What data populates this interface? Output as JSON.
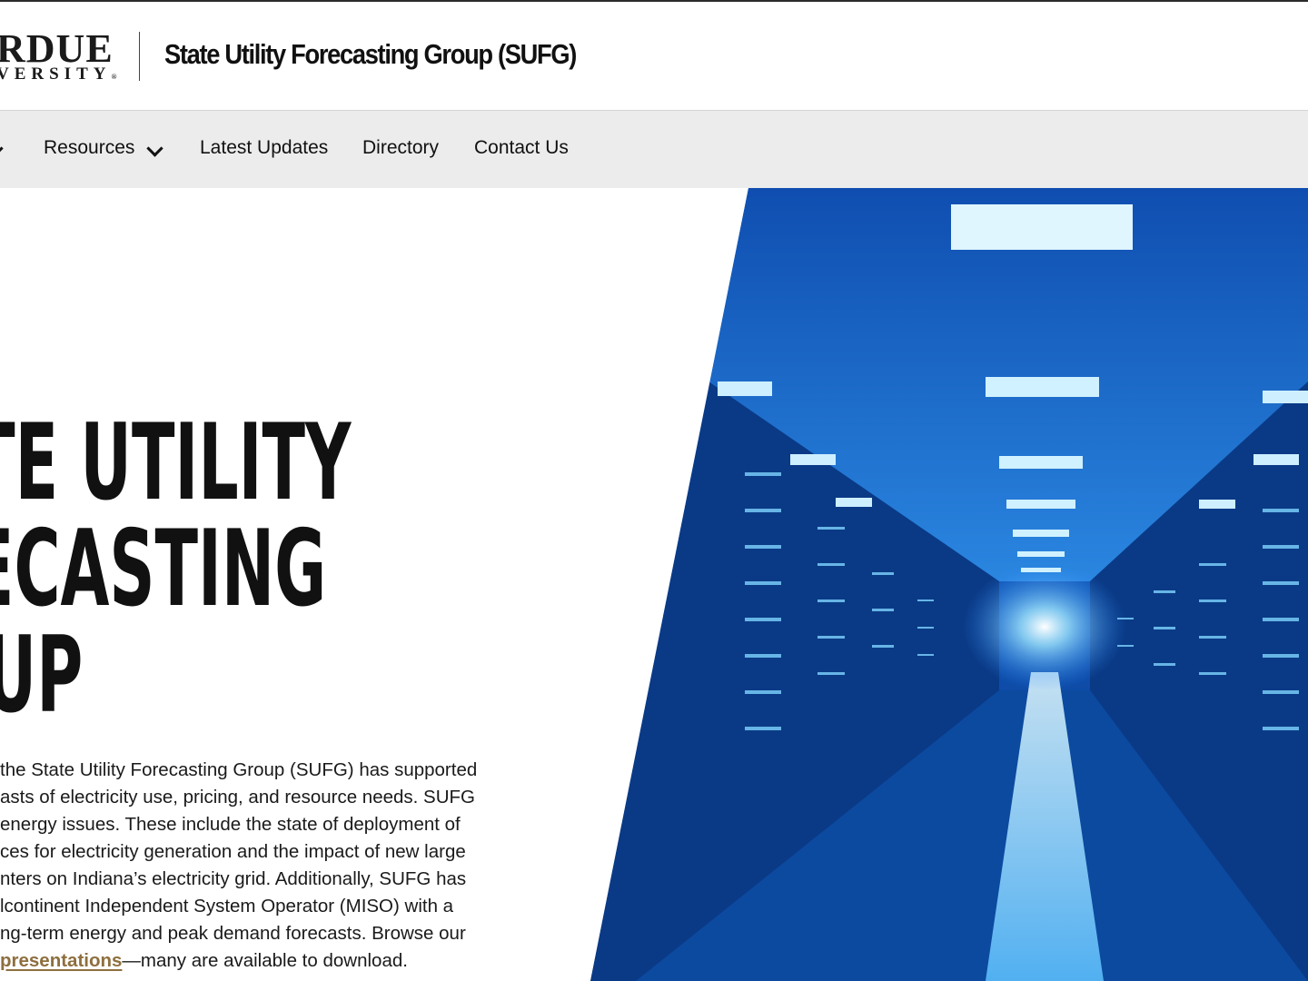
{
  "header": {
    "logo_top": "RDUE",
    "logo_bottom": "VERSITY",
    "logo_mark": "®",
    "site_title": "State Utility Forecasting Group (SUFG)"
  },
  "nav": {
    "items": [
      {
        "label": "",
        "has_dropdown": true
      },
      {
        "label": "Resources",
        "has_dropdown": true
      },
      {
        "label": "Latest Updates",
        "has_dropdown": false
      },
      {
        "label": "Directory",
        "has_dropdown": false
      },
      {
        "label": "Contact Us",
        "has_dropdown": false
      }
    ]
  },
  "hero": {
    "title_lines": [
      "TE UTILITY",
      "ECASTING",
      "UP"
    ],
    "image_icon": "data-center-server-corridor-photo",
    "body_lines": [
      "the State Utility Forecasting Group (SUFG) has supported",
      "asts of electricity use, pricing, and resource needs. SUFG",
      "energy issues. These include the state of deployment of",
      "ces for electricity generation and the impact of new large",
      "nters on Indiana’s electricity grid. Additionally, SUFG has",
      "lcontinent Independent System Operator (MISO) with a",
      "ng-term energy and peak demand forecasts. Browse our"
    ],
    "last_line_link": "presentations",
    "last_line_rest": "—many are available to download."
  },
  "colors": {
    "nav_bg": "#ececec",
    "link_gold": "#8e6f3e",
    "image_blue": "#1e6fd0"
  }
}
